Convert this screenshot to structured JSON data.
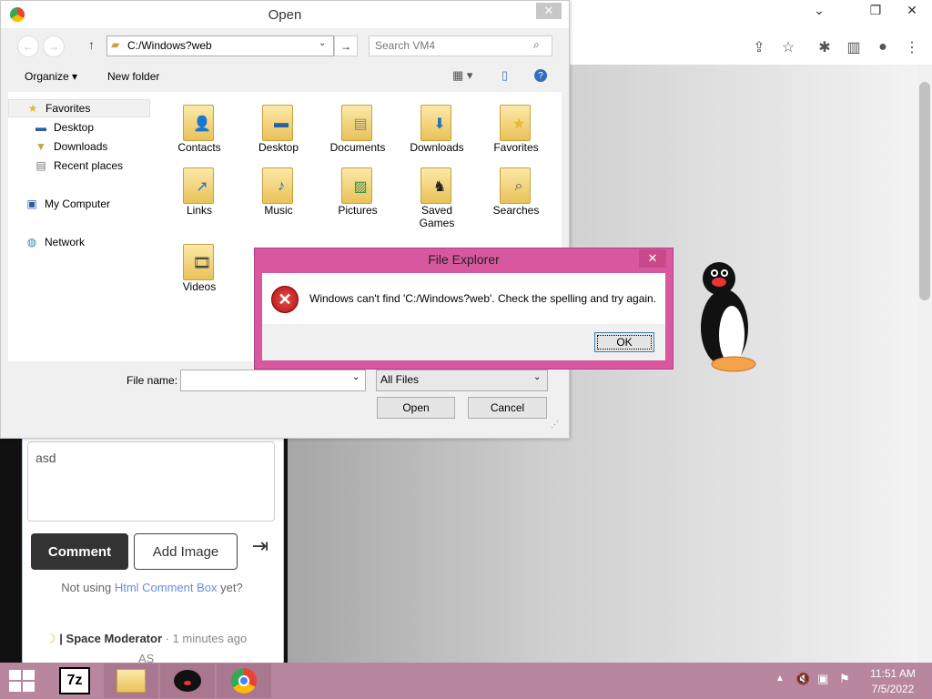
{
  "browser": {
    "window_controls": {
      "minimize": "⌄",
      "restore": "❐",
      "close": "✕"
    },
    "toolbar_icons": [
      "share-icon",
      "star-icon",
      "extensions-icon",
      "sidebar-icon",
      "profile-icon",
      "menu-icon"
    ]
  },
  "open_dialog": {
    "title": "Open",
    "address": "C:/Windows?web",
    "search_placeholder": "Search VM4",
    "organize_label": "Organize",
    "new_folder_label": "New folder",
    "nav": {
      "favorites": "Favorites",
      "desktop": "Desktop",
      "downloads": "Downloads",
      "recent_places": "Recent places",
      "my_computer": "My Computer",
      "network": "Network"
    },
    "files": [
      {
        "label": "Contacts",
        "icon": "contacts-icon"
      },
      {
        "label": "Desktop",
        "icon": "desktop-icon"
      },
      {
        "label": "Documents",
        "icon": "documents-icon"
      },
      {
        "label": "Downloads",
        "icon": "downloads-icon"
      },
      {
        "label": "Favorites",
        "icon": "favorites-icon"
      },
      {
        "label": "Links",
        "icon": "links-icon"
      },
      {
        "label": "Music",
        "icon": "music-icon"
      },
      {
        "label": "Pictures",
        "icon": "pictures-icon"
      },
      {
        "label": "Saved Games",
        "icon": "saved-games-icon"
      },
      {
        "label": "Searches",
        "icon": "searches-icon"
      },
      {
        "label": "Videos",
        "icon": "videos-icon"
      }
    ],
    "filename_label": "File name:",
    "filename_value": "",
    "filetype_value": "All Files",
    "open_label": "Open",
    "cancel_label": "Cancel"
  },
  "error_dialog": {
    "title": "File Explorer",
    "message": "Windows can't find 'C:/Windows?web'. Check the spelling and try again.",
    "ok_label": "OK"
  },
  "comment_panel": {
    "comment_text": "asd",
    "comment_button": "Comment",
    "add_image_button": "Add Image",
    "not_using_prefix": "Not using",
    "not_using_link": "Html Comment Box",
    "not_using_suffix": "yet?",
    "moderator_name": "| Space Moderator",
    "moderator_time": "· 1 minutes ago",
    "partial_text": "AS"
  },
  "taskbar": {
    "apps": [
      "7zip-icon",
      "file-explorer-icon",
      "pingu-app-icon",
      "chrome-icon"
    ],
    "time": "11:51 AM",
    "date": "7/5/2022"
  }
}
